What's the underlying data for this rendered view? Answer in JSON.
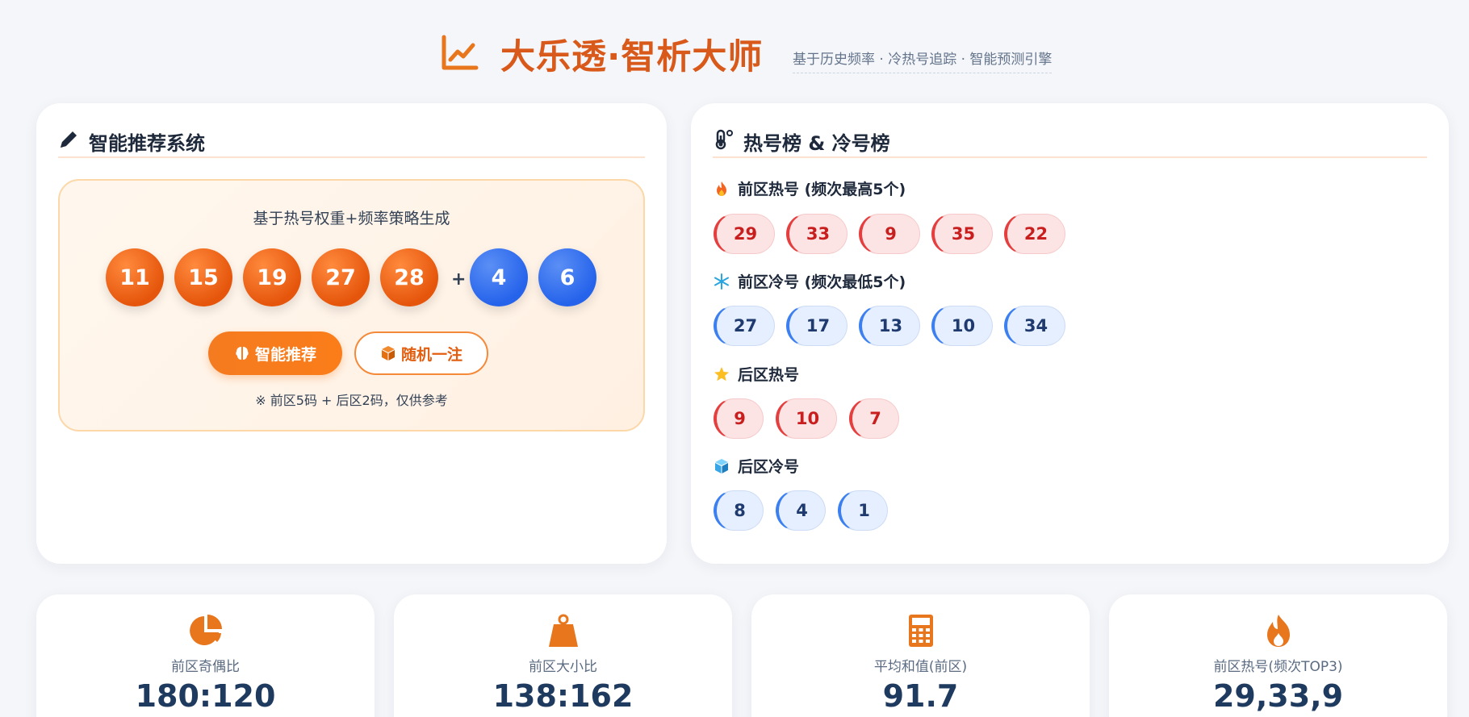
{
  "header": {
    "title": "大乐透·智析大师",
    "subtitle": "基于历史频率 · 冷热号追踪 · 智能预测引擎",
    "icon": "chart-line-icon"
  },
  "recommend": {
    "title": "智能推荐系统",
    "icon": "pen-icon",
    "description": "基于热号权重+频率策略生成",
    "front_numbers": [
      "11",
      "15",
      "19",
      "27",
      "28"
    ],
    "back_numbers": [
      "4",
      "6"
    ],
    "plus": "+",
    "smart_button": "智能推荐",
    "smart_button_icon": "brain-icon",
    "random_button": "随机一注",
    "random_button_icon": "cube-icon",
    "note": "※ 前区5码 + 后区2码，仅供参考"
  },
  "hotcold": {
    "title": "热号榜 & 冷号榜",
    "icon": "thermometer-icon",
    "front_hot_label": "前区热号 (频次最高5个)",
    "front_hot": [
      "29",
      "33",
      "9",
      "35",
      "22"
    ],
    "front_cold_label": "前区冷号 (频次最低5个)",
    "front_cold": [
      "27",
      "17",
      "13",
      "10",
      "34"
    ],
    "back_hot_label": "后区热号",
    "back_hot": [
      "9",
      "10",
      "7"
    ],
    "back_cold_label": "后区冷号",
    "back_cold": [
      "8",
      "4",
      "1"
    ]
  },
  "stats": [
    {
      "label": "前区奇偶比",
      "value": "180:120",
      "icon": "pie-chart-icon"
    },
    {
      "label": "前区大小比",
      "value": "138:162",
      "icon": "weight-icon"
    },
    {
      "label": "平均和值(前区)",
      "value": "91.7",
      "icon": "calculator-icon"
    },
    {
      "label": "前区热号(频次TOP3)",
      "value": "29,33,9",
      "icon": "fire-icon"
    }
  ],
  "colors": {
    "accent": "#f47b1f",
    "title": "#d9591a",
    "front_ball": "#e5560c",
    "back_ball": "#2563eb",
    "hot": "#c81e1e",
    "cold": "#1e3a6e"
  }
}
